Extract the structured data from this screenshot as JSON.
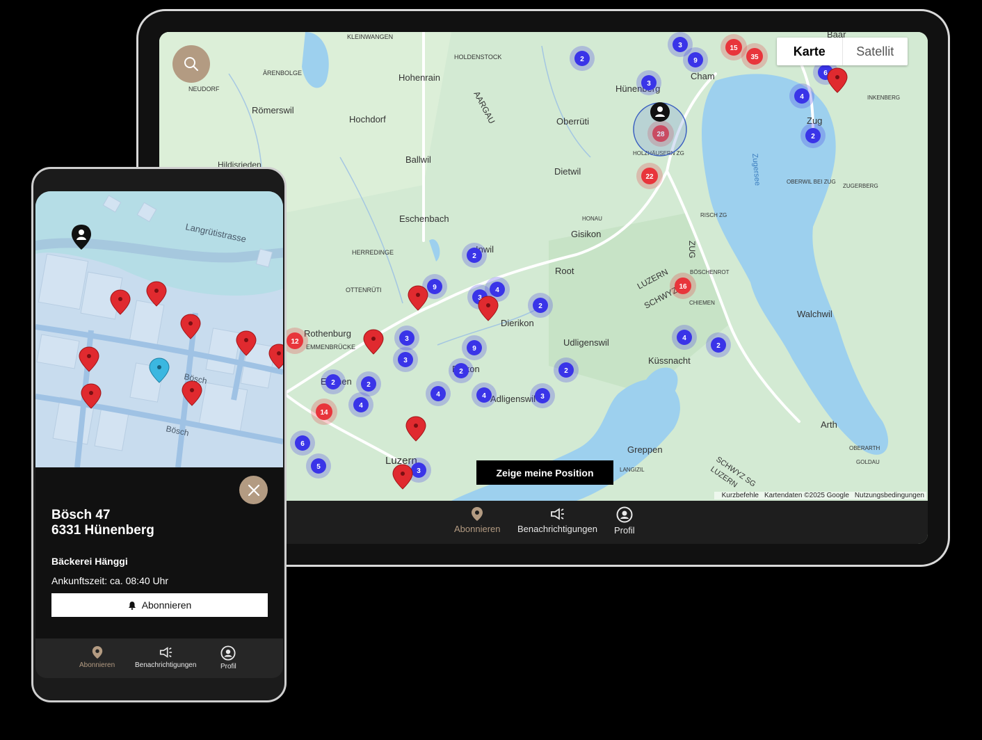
{
  "tablet": {
    "map_toggle": {
      "map": "Karte",
      "satellite": "Satellit"
    },
    "show_position": "Zeige meine Position",
    "attribution": {
      "shortcuts": "Kurzbefehle",
      "data": "Kartendaten ©2025 Google",
      "terms": "Nutzungsbedingungen"
    },
    "nav": {
      "subscribe": "Abonnieren",
      "notifications": "Benachrichtigungen",
      "profile": "Profil"
    },
    "places": [
      "KLEINWANGEN",
      "HOLDENSTOCK",
      "Hohenrain",
      "Römerswil",
      "Hochdorf",
      "Ballwil",
      "Eschenbach",
      "Oberrüti",
      "Dietwil",
      "Gisikon",
      "Root",
      "Inwil",
      "Dierikon",
      "Udligenswil",
      "Küssnacht",
      "Rothenburg",
      "EMMENBRÜCKE",
      "Emmen",
      "Ebikon",
      "Adligenswil",
      "Luzern",
      "Greppen",
      "Arth",
      "Walchwil",
      "Zug",
      "Cham",
      "Hünenberg",
      "Baar",
      "HOLZHÄUSERN ZG",
      "HERREDINGE",
      "OTTENRÜTI",
      "ÄRENBOLGE",
      "NEUDORF",
      "Hildisrieden",
      "LUZERN",
      "SCHWYZ",
      "AARGAU",
      "ZUG",
      "Zugersee",
      "RISCH ZG",
      "BÖSCHENROT",
      "CHIEMEN",
      "HONAU",
      "OBERWIL BEI ZUG",
      "ZUGERBERG",
      "INKENBERG",
      "OBERARTH",
      "GOLDAU",
      "LANGIZIL",
      "SCHWYZ SG",
      "LUZERN"
    ],
    "clusters_blue": [
      "2",
      "3",
      "9",
      "3",
      "6",
      "4",
      "2",
      "2",
      "9",
      "3",
      "4",
      "2",
      "3",
      "3",
      "9",
      "2",
      "2",
      "4",
      "6",
      "5",
      "4",
      "4",
      "3",
      "2",
      "2",
      "4",
      "2",
      "3"
    ],
    "clusters_red": [
      "15",
      "35",
      "28",
      "22",
      "16",
      "12",
      "14"
    ]
  },
  "phone": {
    "streets": {
      "langruti": "Langrütistrasse",
      "bosch1": "Bösch",
      "bosch2": "Bösch"
    },
    "address_line1": "Bösch 47",
    "address_line2": "6331 Hünenberg",
    "business": "Bäckerei Hänggi",
    "arrival": "Ankunftszeit: ca. 08:40 Uhr",
    "subscribe_button": "Abonnieren",
    "nav": {
      "subscribe": "Abonnieren",
      "notifications": "Benachrichtigungen",
      "profile": "Profil"
    }
  },
  "colors": {
    "accent": "#b39b82",
    "cluster_blue": "#3a34e8",
    "cluster_red": "#e8353b",
    "water": "#9dd0ee",
    "land": "#cfe8d0"
  }
}
